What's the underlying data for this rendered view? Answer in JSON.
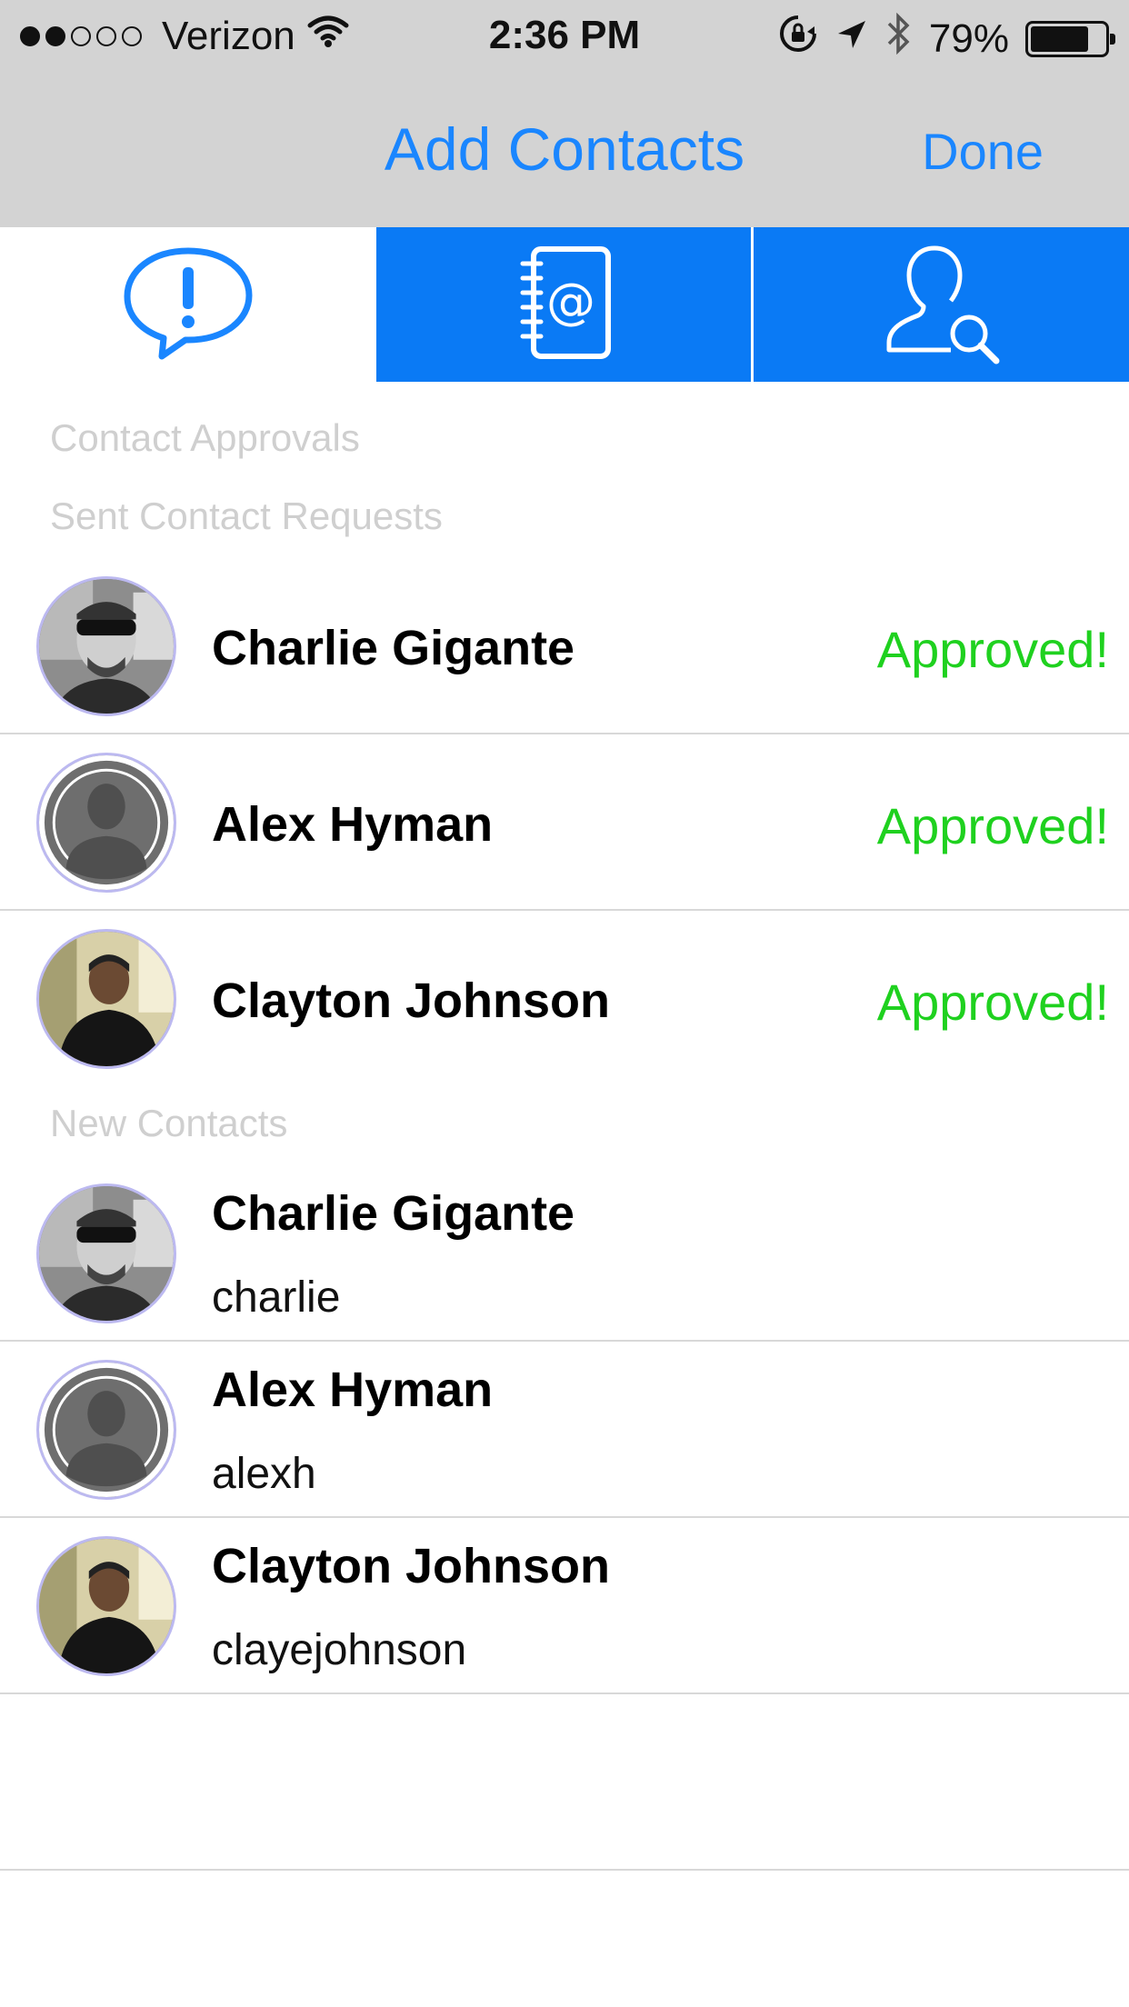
{
  "status_bar": {
    "carrier": "Verizon",
    "time": "2:36 PM",
    "battery": "79%",
    "battery_level": 0.79,
    "signal_bars_filled": 2,
    "signal_bars_total": 5
  },
  "nav": {
    "title": "Add Contacts",
    "done_label": "Done"
  },
  "tabs": [
    {
      "icon": "alert-bubble-icon",
      "selected": true
    },
    {
      "icon": "address-book-icon",
      "selected": false
    },
    {
      "icon": "user-search-icon",
      "selected": false
    }
  ],
  "sections": {
    "contact_approvals": "Contact Approvals",
    "sent_requests": "Sent Contact Requests",
    "new_contacts": "New Contacts"
  },
  "sent_requests": [
    {
      "name": "Charlie Gigante",
      "status": "Approved!",
      "avatar": "photo"
    },
    {
      "name": "Alex Hyman",
      "status": "Approved!",
      "avatar": "placeholder"
    },
    {
      "name": "Clayton Johnson",
      "status": "Approved!",
      "avatar": "photo"
    }
  ],
  "new_contacts": [
    {
      "name": "Charlie Gigante",
      "username": "charlie",
      "avatar": "photo"
    },
    {
      "name": "Alex Hyman",
      "username": "alexh",
      "avatar": "placeholder"
    },
    {
      "name": "Clayton Johnson",
      "username": "clayejohnson",
      "avatar": "photo"
    }
  ],
  "colors": {
    "accent": "#1a86ff",
    "tab_blue": "#0a7af5",
    "approved_green": "#1fd11f",
    "nav_bg": "#d3d3d3",
    "section_text": "#cfcfcf"
  }
}
